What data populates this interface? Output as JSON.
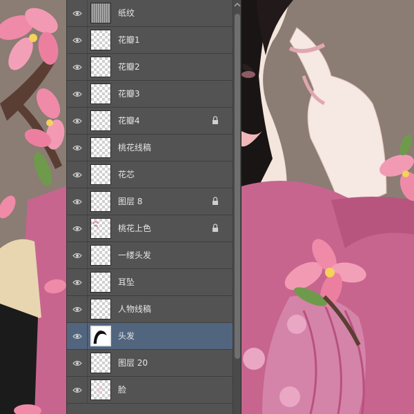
{
  "layers_panel": {
    "layers": [
      {
        "name": "纸纹",
        "locked": false,
        "selected": false,
        "thumb": "texture"
      },
      {
        "name": "花瓣1",
        "locked": false,
        "selected": false,
        "thumb": "transparent"
      },
      {
        "name": "花瓣2",
        "locked": false,
        "selected": false,
        "thumb": "transparent"
      },
      {
        "name": "花瓣3",
        "locked": false,
        "selected": false,
        "thumb": "transparent"
      },
      {
        "name": "花瓣4",
        "locked": true,
        "selected": false,
        "thumb": "transparent"
      },
      {
        "name": "桃花线稿",
        "locked": false,
        "selected": false,
        "thumb": "transparent"
      },
      {
        "name": "花芯",
        "locked": false,
        "selected": false,
        "thumb": "transparent"
      },
      {
        "name": "图层 8",
        "locked": true,
        "selected": false,
        "thumb": "transparent"
      },
      {
        "name": "桃花上色",
        "locked": true,
        "selected": false,
        "thumb": "pink-sketch"
      },
      {
        "name": "一缕头发",
        "locked": false,
        "selected": false,
        "thumb": "transparent"
      },
      {
        "name": "耳坠",
        "locked": false,
        "selected": false,
        "thumb": "transparent"
      },
      {
        "name": "人物线稿",
        "locked": false,
        "selected": false,
        "thumb": "transparent"
      },
      {
        "name": "头发",
        "locked": false,
        "selected": true,
        "thumb": "hair"
      },
      {
        "name": "图层 20",
        "locked": false,
        "selected": false,
        "thumb": "transparent"
      },
      {
        "name": "脸",
        "locked": false,
        "selected": false,
        "thumb": "face"
      }
    ]
  },
  "colors": {
    "panel_bg": "#535353",
    "selected_row": "#52657f",
    "canvas_bg": "#8b7c74",
    "robe_pink": "#c7658f",
    "blossom_pink": "#ef8aa8"
  }
}
